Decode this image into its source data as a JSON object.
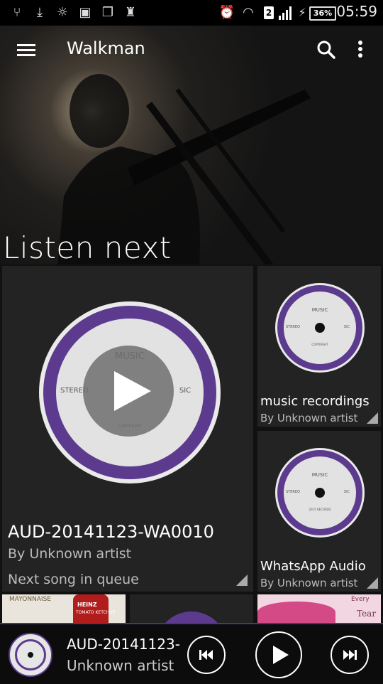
{
  "status_bar": {
    "time": "05:59",
    "battery": "36%",
    "sim": "2",
    "icons": [
      "usb-icon",
      "download-icon",
      "bulb-icon",
      "image-icon",
      "chat-icon",
      "android-icon",
      "alarm-icon",
      "wifi-icon",
      "signal-icon",
      "charging-icon"
    ]
  },
  "app_bar": {
    "title": "Walkman"
  },
  "section": {
    "title": "Listen next"
  },
  "disc_label": {
    "music": "MUSIC",
    "stereo": "STEREO",
    "sic": "SIC",
    "copyright": "COPYRIGHT",
    "records": "2015 RECORDS"
  },
  "cards": [
    {
      "title": "AUD-20141123-WA0010",
      "subtitle": "By Unknown artist",
      "note": "Next song in queue"
    },
    {
      "title": "music recordings",
      "subtitle": "By Unknown artist"
    },
    {
      "title": "WhatsApp Audio",
      "subtitle": "By Unknown artist"
    }
  ],
  "thumb_strip": {
    "mayonnaise": "MAYONNAISE",
    "heinz": "HEINZ",
    "ketchup": "TOMATO KETCHUP",
    "every": "Every",
    "tear": "Tear"
  },
  "player": {
    "track": "AUD-20141123-",
    "artist": "Unknown artist"
  },
  "colors": {
    "accent": "#5c3b8e",
    "card_bg": "#232323"
  }
}
